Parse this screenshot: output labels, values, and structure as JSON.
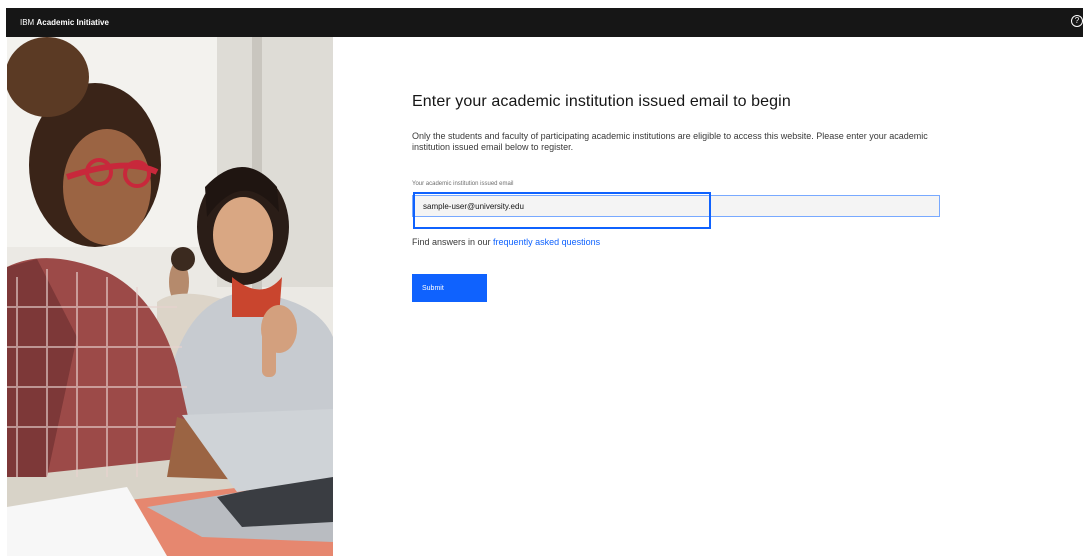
{
  "header": {
    "brand_prefix": "IBM",
    "brand_name": "Academic Initiative",
    "help_glyph": "?"
  },
  "main": {
    "title": "Enter your academic institution issued email to begin",
    "description": "Only the students and faculty of participating academic institutions are eligible to access this website. Please enter your academic institution issued email below to register.",
    "email_label": "Your academic institution issued email",
    "email_value": "sample-user@university.edu",
    "faq_prefix": "Find answers in our ",
    "faq_link": "frequently asked questions",
    "submit_label": "Submit"
  },
  "colors": {
    "header_bg": "#161616",
    "accent": "#0f62fe",
    "link": "#0f62fe",
    "input_bg": "#f4f4f4"
  },
  "icons": {
    "help": "help-circle-icon"
  }
}
